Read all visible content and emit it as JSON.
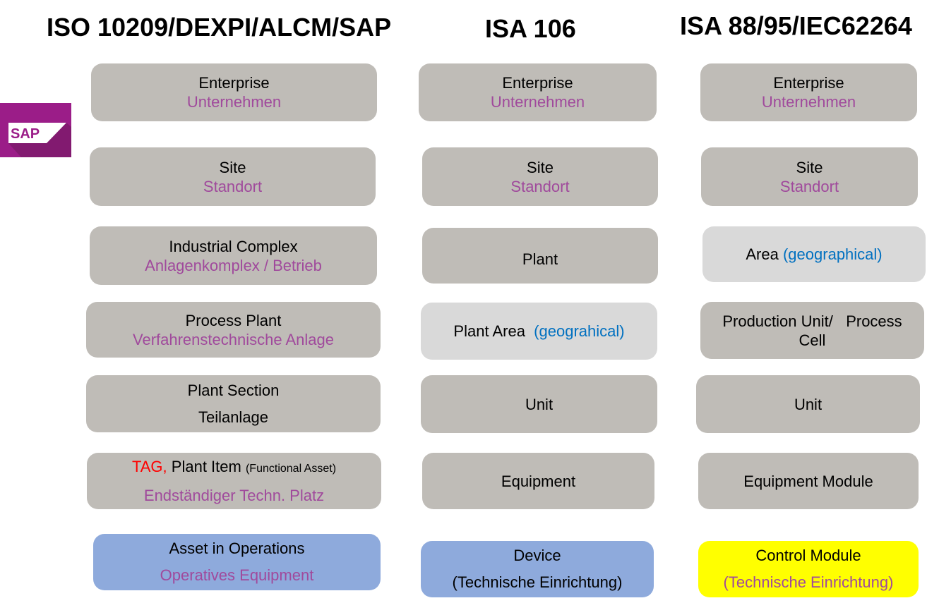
{
  "columns": [
    {
      "title": "ISO 10209/DEXPI/ALCM/SAP"
    },
    {
      "title": "ISA 106"
    },
    {
      "title": "ISA 88/95/IEC62264"
    }
  ],
  "sap_logo": {
    "text": "SAP",
    "icon": "sap-logo-icon"
  },
  "colors": {
    "gray_box": "#bfbcb7",
    "light_box": "#d9d9d9",
    "blue_box": "#8eaadc",
    "yellow_box": "#ffff00",
    "german_text": "#a04a9c",
    "geo_text": "#0070c0",
    "tag_text": "#ff0000",
    "sap_purple": "#9b1d88"
  },
  "iso": {
    "enterprise": {
      "en": "Enterprise",
      "de": "Unternehmen"
    },
    "site": {
      "en": "Site",
      "de": "Standort"
    },
    "industrial_complex": {
      "en": "Industrial Complex",
      "de": "Anlagenkomplex / Betrieb"
    },
    "process_plant": {
      "en": "Process Plant",
      "de": "Verfahrenstechnische Anlage"
    },
    "plant_section": {
      "en": "Plant Section",
      "de": "Teilanlage"
    },
    "plant_item": {
      "tag": "TAG,",
      "en": "Plant Item",
      "note": "(Functional Asset)",
      "de": "Endständiger Techn. Platz"
    },
    "asset_ops": {
      "en": "Asset in Operations",
      "de": "Operatives Equipment"
    }
  },
  "isa106": {
    "enterprise": {
      "en": "Enterprise",
      "de": "Unternehmen"
    },
    "site": {
      "en": "Site",
      "de": "Standort"
    },
    "plant": {
      "en": "Plant"
    },
    "plant_area": {
      "en": "Plant Area",
      "note": "(geograhical)"
    },
    "unit": {
      "en": "Unit"
    },
    "equipment": {
      "en": "Equipment"
    },
    "device": {
      "en": "Device",
      "de": "(Technische Einrichtung)"
    }
  },
  "isa88": {
    "enterprise": {
      "en": "Enterprise",
      "de": "Unternehmen"
    },
    "site": {
      "en": "Site",
      "de": "Standort"
    },
    "area": {
      "en": "Area",
      "note": "(geographical)"
    },
    "production_unit": {
      "line1": "Production Unit/   Process",
      "line2": "Cell"
    },
    "unit": {
      "en": "Unit"
    },
    "equipment_module": {
      "en": "Equipment Module"
    },
    "control_module": {
      "en": "Control Module",
      "de": "(Technische Einrichtung)"
    }
  }
}
